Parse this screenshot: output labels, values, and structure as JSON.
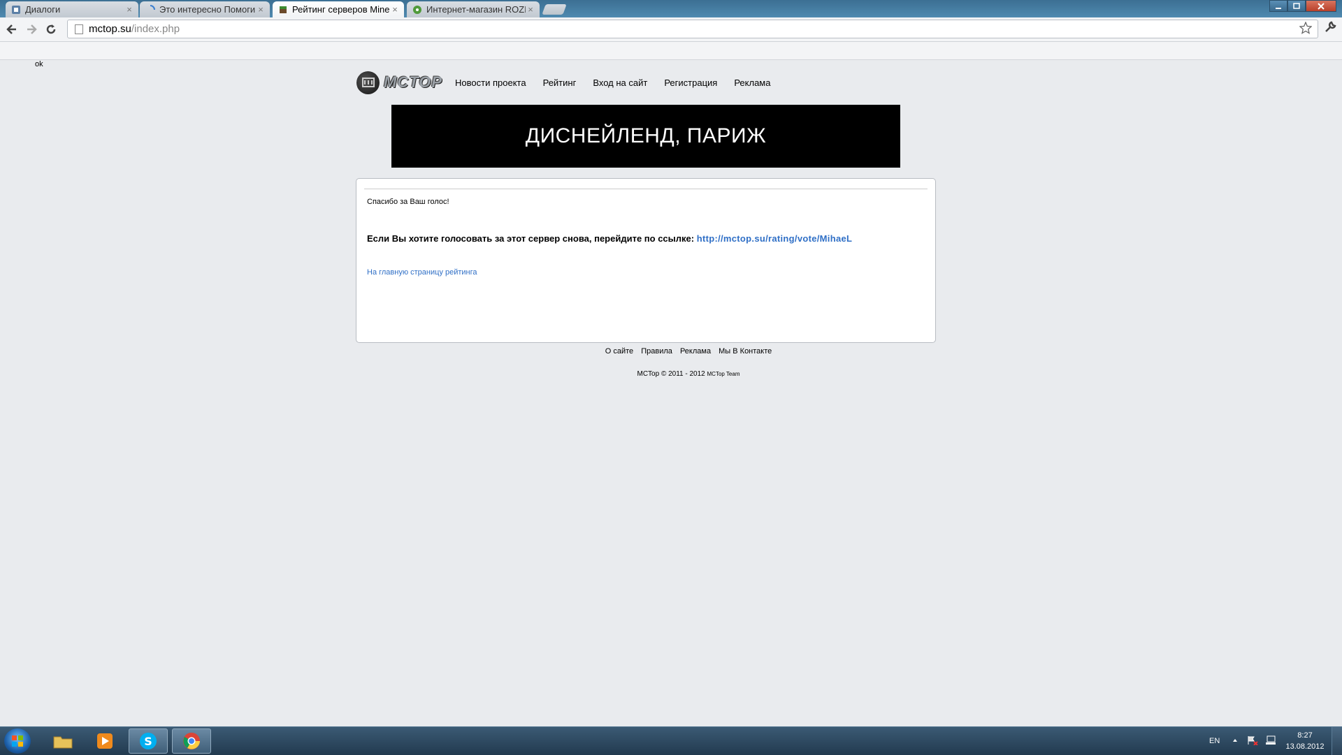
{
  "browser": {
    "tabs": [
      {
        "title": "Диалоги",
        "active": false
      },
      {
        "title": "Это интересно Помоги GI",
        "active": false
      },
      {
        "title": "Рейтинг серверов Minecra",
        "active": true
      },
      {
        "title": "Интернет-магазин ROZET",
        "active": false
      }
    ],
    "close_glyph": "×",
    "url_host": "mctop.su",
    "url_path": "/index.php"
  },
  "page": {
    "corner_text": "ok",
    "logo_text": "MCTOP",
    "nav": [
      "Новости проекта",
      "Рейтинг",
      "Вход на сайт",
      "Регистрация",
      "Реклама"
    ],
    "banner_text": "ДИСНЕЙЛЕНД, ПАРИЖ",
    "thanks_text": "Спасибо за Ваш голос!",
    "revote_text": "Если Вы хотите голосовать за этот сервер снова, перейдите по ссылке:",
    "revote_link": "http://mctop.su/rating/vote/MihaeL",
    "home_link": "На главную страницу рейтинга",
    "footer_links": [
      "О сайте",
      "Правила",
      "Реклама",
      "Мы В Контакте"
    ],
    "copyright": "MCTop © 2011 - 2012",
    "copyright_team": "MCTop Team"
  },
  "taskbar": {
    "language": "EN",
    "time": "8:27",
    "date": "13.08.2012"
  },
  "colors": {
    "link": "#2f6fc6",
    "page_bg": "#e9ebee",
    "banner_bg": "#000000"
  }
}
